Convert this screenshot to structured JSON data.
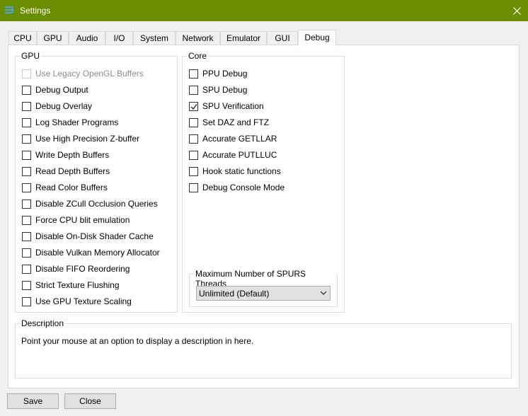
{
  "window": {
    "title": "Settings"
  },
  "tabs": [
    "CPU",
    "GPU",
    "Audio",
    "I/O",
    "System",
    "Network",
    "Emulator",
    "GUI",
    "Debug"
  ],
  "active_tab": "Debug",
  "gpu_group": {
    "title": "GPU",
    "options": [
      {
        "label": "Use Legacy OpenGL Buffers",
        "checked": false,
        "disabled": true
      },
      {
        "label": "Debug Output",
        "checked": false,
        "disabled": false
      },
      {
        "label": "Debug Overlay",
        "checked": false,
        "disabled": false
      },
      {
        "label": "Log Shader Programs",
        "checked": false,
        "disabled": false
      },
      {
        "label": "Use High Precision Z-buffer",
        "checked": false,
        "disabled": false
      },
      {
        "label": "Write Depth Buffers",
        "checked": false,
        "disabled": false
      },
      {
        "label": "Read Depth Buffers",
        "checked": false,
        "disabled": false
      },
      {
        "label": "Read Color Buffers",
        "checked": false,
        "disabled": false
      },
      {
        "label": "Disable ZCull Occlusion Queries",
        "checked": false,
        "disabled": false
      },
      {
        "label": "Force CPU blit emulation",
        "checked": false,
        "disabled": false
      },
      {
        "label": "Disable On-Disk Shader Cache",
        "checked": false,
        "disabled": false
      },
      {
        "label": "Disable Vulkan Memory Allocator",
        "checked": false,
        "disabled": false
      },
      {
        "label": "Disable FIFO Reordering",
        "checked": false,
        "disabled": false
      },
      {
        "label": "Strict Texture Flushing",
        "checked": false,
        "disabled": false
      },
      {
        "label": "Use GPU Texture Scaling",
        "checked": false,
        "disabled": false
      }
    ]
  },
  "core_group": {
    "title": "Core",
    "options": [
      {
        "label": "PPU Debug",
        "checked": false
      },
      {
        "label": "SPU Debug",
        "checked": false
      },
      {
        "label": "SPU Verification",
        "checked": true
      },
      {
        "label": "Set DAZ and FTZ",
        "checked": false
      },
      {
        "label": "Accurate GETLLAR",
        "checked": false
      },
      {
        "label": "Accurate PUTLLUC",
        "checked": false
      },
      {
        "label": "Hook static functions",
        "checked": false
      },
      {
        "label": "Debug Console Mode",
        "checked": false
      }
    ],
    "spurs": {
      "title": "Maximum Number of SPURS Threads",
      "selected": "Unlimited (Default)"
    }
  },
  "description": {
    "title": "Description",
    "text": "Point your mouse at an option to display a description in here."
  },
  "buttons": {
    "save": "Save",
    "close": "Close"
  },
  "colors": {
    "titlebar": "#6b8e00",
    "panel": "#ffffff",
    "window": "#f0f0f0"
  }
}
